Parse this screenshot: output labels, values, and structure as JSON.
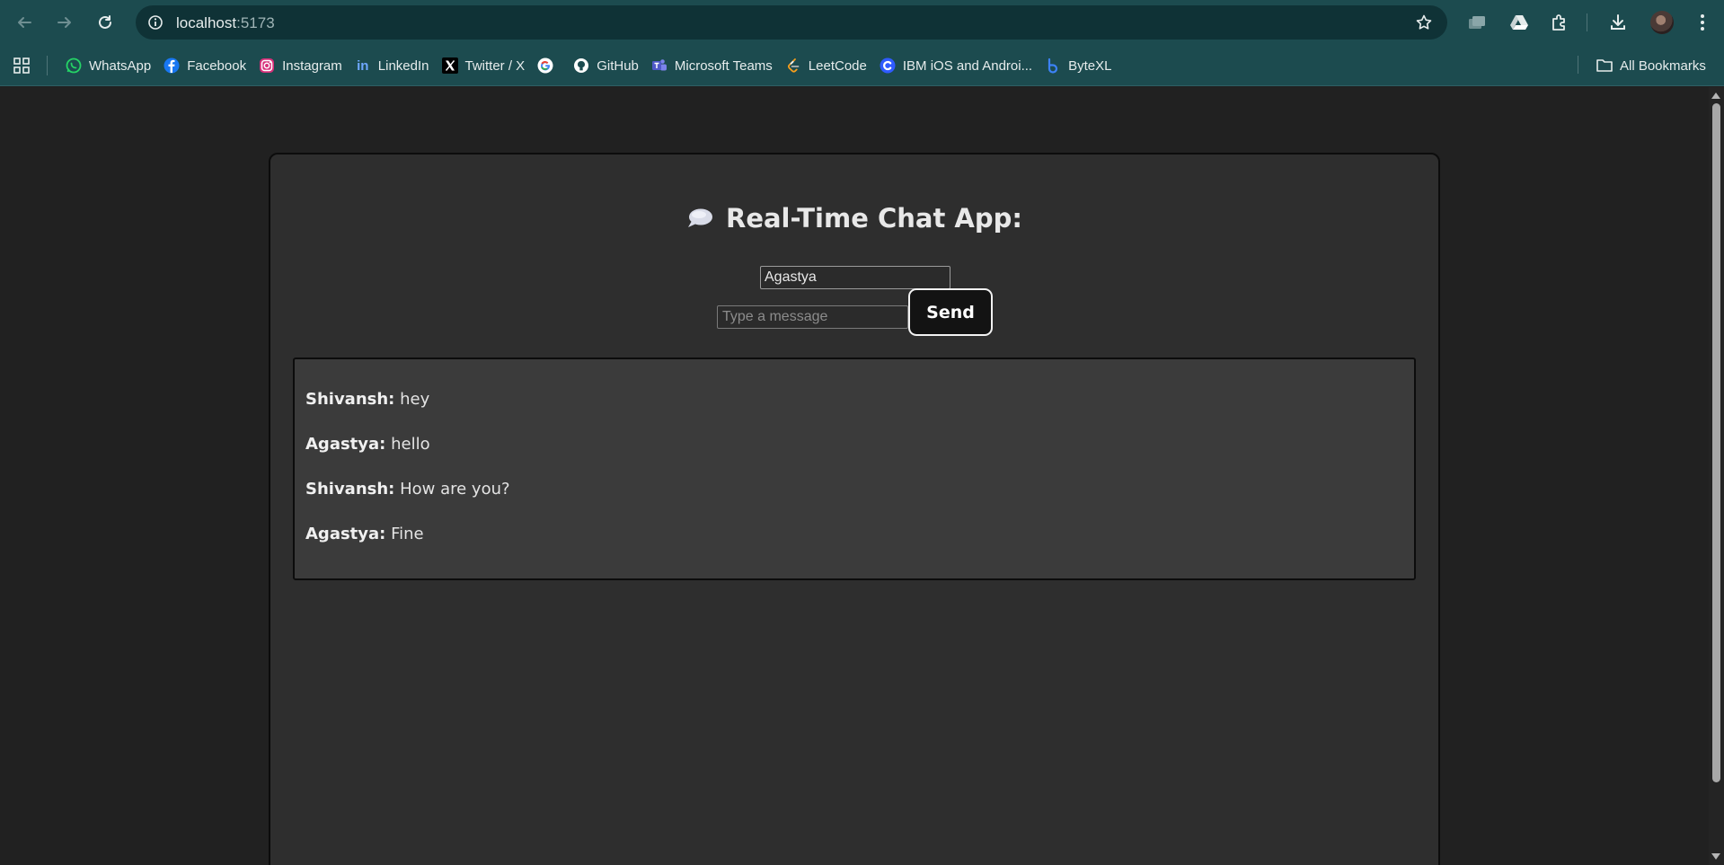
{
  "browser": {
    "url_host": "localhost",
    "url_port": ":5173",
    "toolbar_icons": [
      "back-icon",
      "forward-icon",
      "reload-icon",
      "site-info-icon",
      "bookmark-star-icon",
      "tab-search-icon",
      "drive-icon",
      "extensions-icon",
      "download-icon",
      "profile-avatar",
      "menu-icon"
    ]
  },
  "bookmarks": {
    "items": [
      {
        "label": "WhatsApp",
        "icon": "whatsapp-icon",
        "color": "#25d366"
      },
      {
        "label": "Facebook",
        "icon": "facebook-icon",
        "color": "#1877f2"
      },
      {
        "label": "Instagram",
        "icon": "instagram-icon",
        "color": "#e1306c"
      },
      {
        "label": "LinkedIn",
        "icon": "linkedin-icon",
        "color": "#2d6bbd"
      },
      {
        "label": "Twitter / X",
        "icon": "x-icon",
        "color": "#000000"
      },
      {
        "label": "",
        "icon": "google-icon",
        "color": "#ffffff"
      },
      {
        "label": "GitHub",
        "icon": "github-icon",
        "color": "#ffffff"
      },
      {
        "label": "Microsoft Teams",
        "icon": "teams-icon",
        "color": "#6264a7"
      },
      {
        "label": "LeetCode",
        "icon": "leetcode-icon",
        "color": "#f89f1b"
      },
      {
        "label": "IBM iOS and Androi...",
        "icon": "ibm-c-icon",
        "color": "#2f5bff"
      },
      {
        "label": "ByteXL",
        "icon": "bytexl-icon",
        "color": "#3c82f6"
      }
    ],
    "all_bookmarks": "All Bookmarks"
  },
  "app": {
    "title": "Real-Time Chat App:",
    "title_icon": "speech-bubble-icon",
    "name_value": "Agastya",
    "message_placeholder": "Type a message",
    "send_label": "Send",
    "messages": [
      {
        "sender": "Shivansh:",
        "text": " hey"
      },
      {
        "sender": "Agastya:",
        "text": " hello"
      },
      {
        "sender": "Shivansh:",
        "text": " How are you?"
      },
      {
        "sender": "Agastya:",
        "text": " Fine"
      }
    ]
  }
}
